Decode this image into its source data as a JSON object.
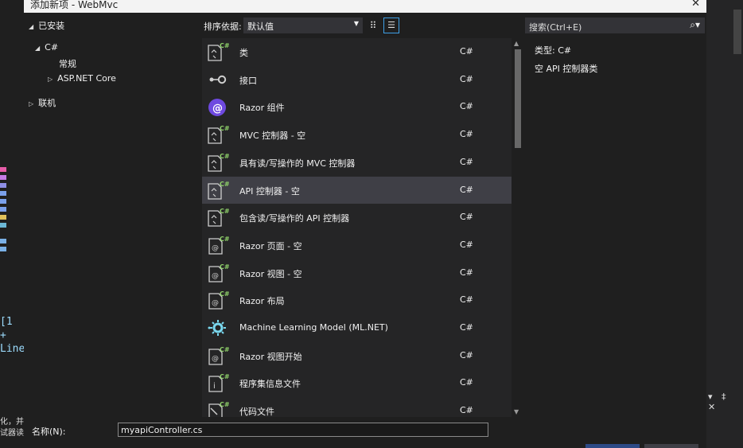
{
  "window": {
    "title": "添加新项 - WebMvc",
    "close": "✕"
  },
  "tree": {
    "installed": "已安装",
    "csharp": "C#",
    "general": "常规",
    "aspnet": "ASP.NET Core",
    "online": "联机"
  },
  "toolbar": {
    "sort_label": "排序依据:",
    "sort_value": "默认值",
    "grid_view_icon": "grid-icon",
    "list_view_icon": "list-icon"
  },
  "search": {
    "placeholder": "搜索(Ctrl+E)"
  },
  "templates": [
    {
      "name": "类",
      "lang": "C#",
      "icon": "class-file-icon"
    },
    {
      "name": "接口",
      "lang": "C#",
      "icon": "interface-icon"
    },
    {
      "name": "Razor 组件",
      "lang": "C#",
      "icon": "razor-component-icon"
    },
    {
      "name": "MVC 控制器 - 空",
      "lang": "C#",
      "icon": "class-file-icon"
    },
    {
      "name": "具有读/写操作的 MVC 控制器",
      "lang": "C#",
      "icon": "class-file-icon"
    },
    {
      "name": "API 控制器 - 空",
      "lang": "C#",
      "icon": "class-file-icon"
    },
    {
      "name": "包含读/写操作的 API 控制器",
      "lang": "C#",
      "icon": "class-file-icon"
    },
    {
      "name": "Razor 页面 - 空",
      "lang": "C#",
      "icon": "razor-file-icon"
    },
    {
      "name": "Razor 视图 - 空",
      "lang": "C#",
      "icon": "razor-file-icon"
    },
    {
      "name": "Razor 布局",
      "lang": "C#",
      "icon": "razor-file-icon"
    },
    {
      "name": "Machine Learning Model (ML.NET)",
      "lang": "C#",
      "icon": "ml-net-icon"
    },
    {
      "name": "Razor 视图开始",
      "lang": "C#",
      "icon": "razor-file-icon"
    },
    {
      "name": "程序集信息文件",
      "lang": "C#",
      "icon": "info-file-icon"
    },
    {
      "name": "代码文件",
      "lang": "C#",
      "icon": "code-file-icon"
    }
  ],
  "selected_index": 5,
  "details": {
    "type": "类型: C#",
    "description": "空 API 控制器类"
  },
  "name_field": {
    "label": "名称(N):",
    "value": "myapiController.cs"
  },
  "background": {
    "code_line1": "[1 +",
    "code_line2": "Line(",
    "text_line1": "化，并",
    "text_line2": "试器读",
    "pane_controls": "▾ ‡ ✕"
  },
  "colors": {
    "dialog_bg": "#1f1f1f",
    "list_bg": "#252526",
    "selected_row": "#3f3f46",
    "accent": "#3ea0e6",
    "csharp_green": "#8fd16a",
    "razor_purple": "#6e49e0"
  }
}
